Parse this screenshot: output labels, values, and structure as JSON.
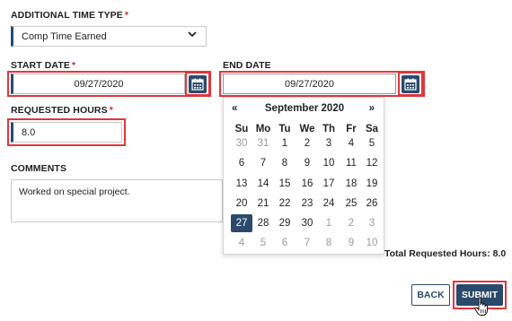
{
  "form": {
    "time_type": {
      "label": "ADDITIONAL TIME TYPE",
      "required_mark": "*",
      "value": "Comp Time Earned"
    },
    "start_date": {
      "label": "START DATE",
      "required_mark": "*",
      "value": "09/27/2020"
    },
    "end_date": {
      "label": "END DATE",
      "value": "09/27/2020"
    },
    "requested_hours": {
      "label": "REQUESTED HOURS",
      "required_mark": "*",
      "value": "8.0"
    },
    "comments": {
      "label": "COMMENTS",
      "value": "Worked on special project."
    },
    "total": "Total Requested Hours:  8.0",
    "back_label": "BACK",
    "submit_label": "SUBMIT"
  },
  "calendar": {
    "prev": "«",
    "next": "»",
    "month_year": "September 2020",
    "weekdays": [
      "Su",
      "Mo",
      "Tu",
      "We",
      "Th",
      "Fr",
      "Sa"
    ],
    "weeks": [
      [
        "30",
        "31",
        "1",
        "2",
        "3",
        "4",
        "5"
      ],
      [
        "6",
        "7",
        "8",
        "9",
        "10",
        "11",
        "12"
      ],
      [
        "13",
        "14",
        "15",
        "16",
        "17",
        "18",
        "19"
      ],
      [
        "20",
        "21",
        "22",
        "23",
        "24",
        "25",
        "26"
      ],
      [
        "27",
        "28",
        "29",
        "30",
        "1",
        "2",
        "3"
      ],
      [
        "4",
        "5",
        "6",
        "7",
        "8",
        "9",
        "10"
      ]
    ],
    "selected_day": "27"
  },
  "colors": {
    "accent": "#2b4a6b",
    "highlight": "#e0363c",
    "required": "#d71f27"
  },
  "icons": {
    "dropdown": "chevron-down-icon",
    "date_picker": "calendar-icon",
    "pointer": "hand-pointer-icon"
  }
}
